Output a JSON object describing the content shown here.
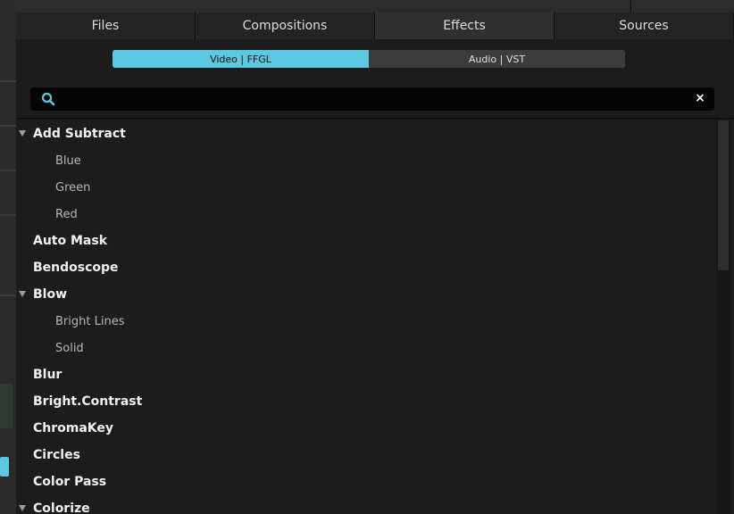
{
  "tabs": [
    {
      "label": "Files"
    },
    {
      "label": "Compositions"
    },
    {
      "label": "Effects"
    },
    {
      "label": "Sources"
    }
  ],
  "active_tab": "Effects",
  "toggle": {
    "video_label": "Video | FFGL",
    "audio_label": "Audio | VST",
    "active": "video"
  },
  "search": {
    "value": "",
    "close_glyph": "×"
  },
  "effects": [
    {
      "label": "Add Subtract",
      "expanded": true
    },
    {
      "label": "Blue",
      "child": true
    },
    {
      "label": "Green",
      "child": true
    },
    {
      "label": "Red",
      "child": true
    },
    {
      "label": "Auto Mask"
    },
    {
      "label": "Bendoscope"
    },
    {
      "label": "Blow",
      "expanded": true
    },
    {
      "label": "Bright Lines",
      "child": true
    },
    {
      "label": "Solid",
      "child": true
    },
    {
      "label": "Blur"
    },
    {
      "label": "Bright.Contrast"
    },
    {
      "label": "ChromaKey"
    },
    {
      "label": "Circles"
    },
    {
      "label": "Color Pass"
    },
    {
      "label": "Colorize",
      "expanded": true
    }
  ],
  "colors": {
    "accent": "#5bc7e0",
    "background": "#1c1c1c"
  },
  "icons": {
    "search": "search-icon",
    "close": "close-icon",
    "expand": "triangle-down-icon"
  }
}
